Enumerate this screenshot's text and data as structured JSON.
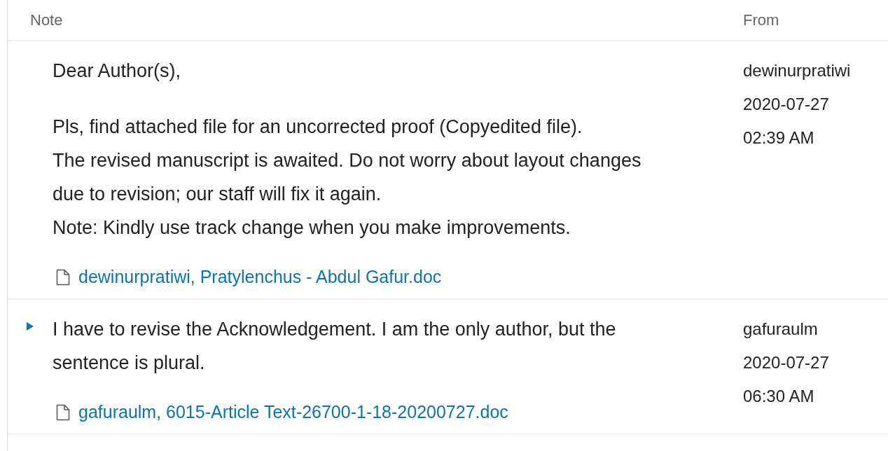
{
  "table": {
    "columns": [
      "Note",
      "From"
    ],
    "rows": [
      {
        "expanded": null,
        "paragraphs": [
          [
            "Dear Author(s),"
          ],
          [
            "Pls, find attached file for an uncorrected proof (Copyedited file).",
            "The revised manuscript is awaited. Do not worry about layout changes due to revision; our staff will fix it again.",
            "Note: Kindly use track change when you make improvements."
          ]
        ],
        "attachment": "dewinurpratiwi, Pratylenchus - Abdul Gafur.doc",
        "from": [
          "dewinurpratiwi",
          "2020-07-27",
          "02:39 AM"
        ]
      },
      {
        "expanded": false,
        "paragraphs": [
          [
            "I have to revise the Acknowledgement. I am the only author, but the sentence is plural."
          ]
        ],
        "attachment": "gafuraulm, 6015-Article Text-26700-1-18-20200727.doc",
        "from": [
          "gafuraulm",
          "2020-07-27",
          "06:30 AM"
        ]
      }
    ]
  }
}
